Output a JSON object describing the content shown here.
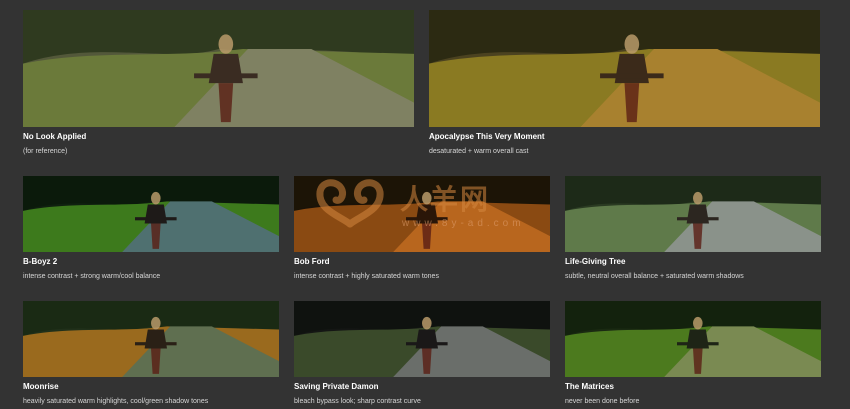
{
  "looks": [
    {
      "title": "No Look Applied",
      "description": "(for reference)",
      "grade": {
        "sky": "#53583a",
        "trees": "#2f3a1f",
        "field": "#6b7a3a",
        "road": "#7f8162",
        "rider": "#3a2c22"
      }
    },
    {
      "title": "Apocalypse This Very Moment",
      "description": "desaturated + warm overall cast",
      "grade": {
        "sky": "#4b4220",
        "trees": "#2c2a12",
        "field": "#8a7a22",
        "road": "#a8812f",
        "rider": "#3b2a1a"
      }
    },
    {
      "title": "B-Boyz 2",
      "description": "intense contrast + strong warm/cool balance",
      "grade": {
        "sky": "#102010",
        "trees": "#0b1a0b",
        "field": "#3d7a1c",
        "road": "#4f7070",
        "rider": "#1e1a18"
      }
    },
    {
      "title": "Bob Ford",
      "description": "intense contrast + highly saturated warm tones",
      "grade": {
        "sky": "#1a1208",
        "trees": "#1c1406",
        "field": "#8a4a12",
        "road": "#b8661e",
        "rider": "#2a1608"
      }
    },
    {
      "title": "Life-Giving Tree",
      "description": "subtle, neutral overall balance + saturated warm shadows",
      "grade": {
        "sky": "#2a3a22",
        "trees": "#1d2a18",
        "field": "#5f7a4a",
        "road": "#8a928a",
        "rider": "#2c2620"
      }
    },
    {
      "title": "Moonrise",
      "description": "heavily saturated warm highlights, cool/green shadow tones",
      "grade": {
        "sky": "#20301a",
        "trees": "#1a2a14",
        "field": "#9a6a1e",
        "road": "#5f6f50",
        "rider": "#2a2016"
      }
    },
    {
      "title": "Saving Private Damon",
      "description": "bleach bypass look; sharp contrast curve",
      "grade": {
        "sky": "#141614",
        "trees": "#0f120f",
        "field": "#3a4a2a",
        "road": "#6a6e6a",
        "rider": "#1a1818"
      }
    },
    {
      "title": "The Matrices",
      "description": "never been done before",
      "grade": {
        "sky": "#1a2a12",
        "trees": "#13220d",
        "field": "#4c7a1e",
        "road": "#7a8a52",
        "rider": "#1e2416"
      }
    }
  ],
  "watermark": {
    "text": "人羊网",
    "url": "www.8y-ad.com",
    "color": "#d4873f"
  }
}
